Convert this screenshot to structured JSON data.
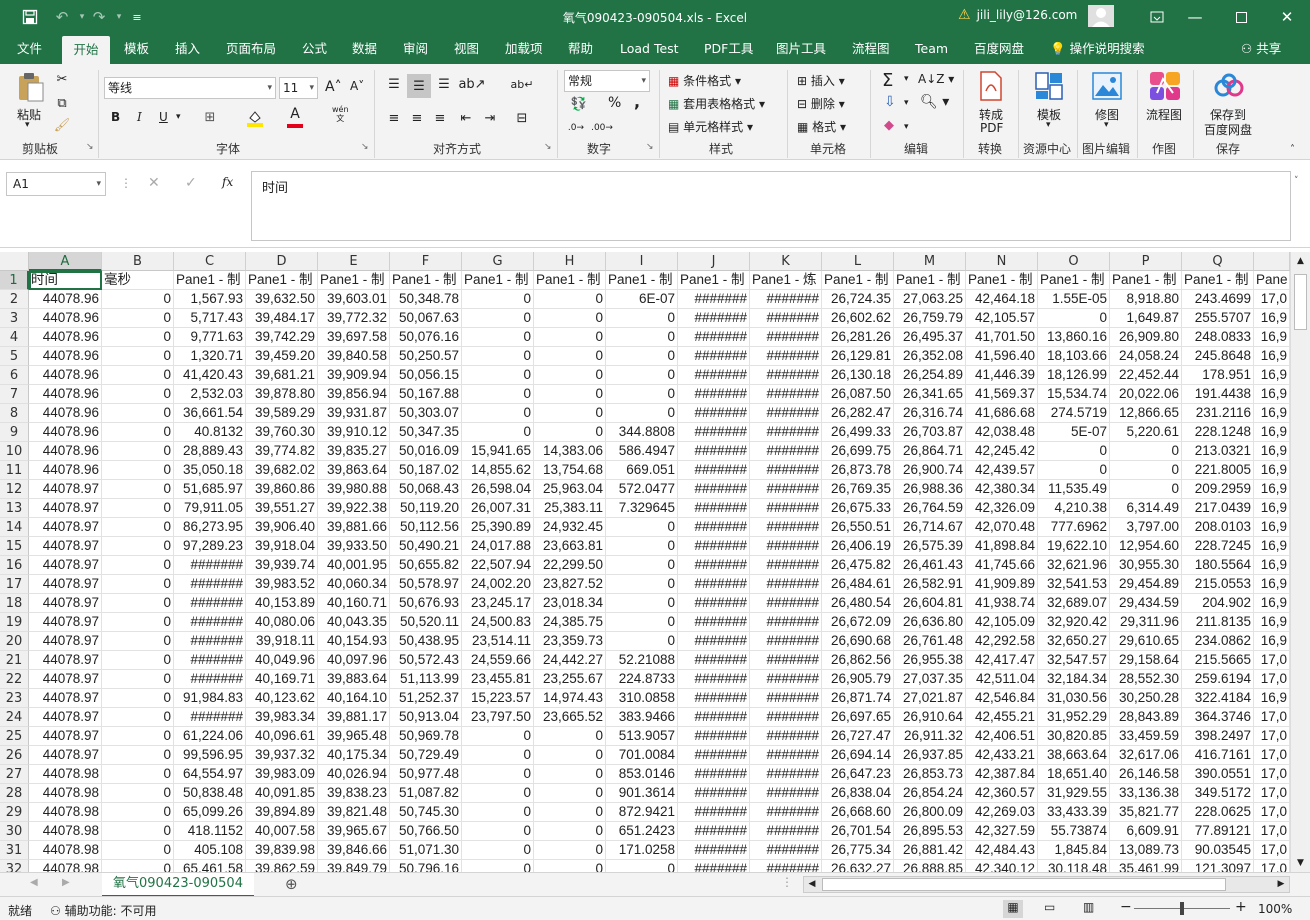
{
  "titlebar": {
    "title": "氧气090423-090504.xls  -  Excel",
    "user": "jili_lily@126.com",
    "save_icon": "save-icon",
    "undo_icon": "undo-icon",
    "redo_icon": "redo-icon",
    "warning_icon": "warning-icon"
  },
  "tabs": [
    "文件",
    "开始",
    "模板",
    "插入",
    "页面布局",
    "公式",
    "数据",
    "审阅",
    "视图",
    "加载项",
    "帮助",
    "Load Test",
    "PDF工具",
    "图片工具",
    "流程图",
    "Team",
    "百度网盘"
  ],
  "tell_me": "操作说明搜索",
  "share": "共享",
  "ribbon": {
    "paste": "粘贴",
    "clipboard": "剪贴板",
    "font_name": "等线",
    "font_size": "11",
    "font_group": "字体",
    "align_group": "对齐方式",
    "number_format": "常规",
    "number_group": "数字",
    "cond_format": "条件格式",
    "table_format": "套用表格格式",
    "cell_style": "单元格样式",
    "style_group": "样式",
    "insert": "插入",
    "delete": "删除",
    "format": "格式",
    "cells_group": "单元格",
    "edit_group": "编辑",
    "to_pdf1": "转成",
    "to_pdf2": "PDF",
    "convert_group": "转换",
    "template": "模板",
    "resource_group": "资源中心",
    "repair": "修图",
    "image_group": "图片编辑",
    "flowchart": "流程图",
    "draw_group": "作图",
    "save_to1": "保存到",
    "save_to2": "百度网盘",
    "save_group": "保存",
    "bold": "B",
    "italic": "I",
    "underline": "U",
    "wen": "wén\n文",
    "percent": "%",
    "comma": ",",
    "inc_font": "A˄",
    "dec_font": "A˅",
    "font_color_char": "A"
  },
  "formula_bar": {
    "name_box": "A1",
    "fx": "fx",
    "content": "时间"
  },
  "columns": [
    "A",
    "B",
    "C",
    "D",
    "E",
    "F",
    "G",
    "H",
    "I",
    "J",
    "K",
    "L",
    "M",
    "N",
    "O",
    "P",
    "Q",
    ""
  ],
  "rows": [
    [
      "时间",
      "毫秒",
      "Pane1 - 制",
      "Pane1 - 制",
      "Pane1 - 制",
      "Pane1 - 制",
      "Pane1 - 制",
      "Pane1 - 制",
      "Pane1 - 制",
      "Pane1 - 制",
      "Pane1 - 炼",
      "Pane1 - 制",
      "Pane1 - 制",
      "Pane1 - 制",
      "Pane1 - 制",
      "Pane1 - 制",
      "Pane1 - 制",
      "Pane"
    ],
    [
      "44078.96",
      "0",
      "1,567.93",
      "39,632.50",
      "39,603.01",
      "50,348.78",
      "0",
      "0",
      "6E-07",
      "#######",
      "#######",
      "26,724.35",
      "27,063.25",
      "42,464.18",
      "1.55E-05",
      "8,918.80",
      "243.4699",
      "17,0"
    ],
    [
      "44078.96",
      "0",
      "5,717.43",
      "39,484.17",
      "39,772.32",
      "50,067.63",
      "0",
      "0",
      "0",
      "#######",
      "#######",
      "26,602.62",
      "26,759.79",
      "42,105.57",
      "0",
      "1,649.87",
      "255.5707",
      "16,9"
    ],
    [
      "44078.96",
      "0",
      "9,771.63",
      "39,742.29",
      "39,697.58",
      "50,076.16",
      "0",
      "0",
      "0",
      "#######",
      "#######",
      "26,281.26",
      "26,495.37",
      "41,701.50",
      "13,860.16",
      "26,909.80",
      "248.0833",
      "16,9"
    ],
    [
      "44078.96",
      "0",
      "1,320.71",
      "39,459.20",
      "39,840.58",
      "50,250.57",
      "0",
      "0",
      "0",
      "#######",
      "#######",
      "26,129.81",
      "26,352.08",
      "41,596.40",
      "18,103.66",
      "24,058.24",
      "245.8648",
      "16,9"
    ],
    [
      "44078.96",
      "0",
      "41,420.43",
      "39,681.21",
      "39,909.94",
      "50,056.15",
      "0",
      "0",
      "0",
      "#######",
      "#######",
      "26,130.18",
      "26,254.89",
      "41,446.39",
      "18,126.99",
      "22,452.44",
      "178.951",
      "16,9"
    ],
    [
      "44078.96",
      "0",
      "2,532.03",
      "39,878.80",
      "39,856.94",
      "50,167.88",
      "0",
      "0",
      "0",
      "#######",
      "#######",
      "26,087.50",
      "26,341.65",
      "41,569.37",
      "15,534.74",
      "20,022.06",
      "191.4438",
      "16,9"
    ],
    [
      "44078.96",
      "0",
      "36,661.54",
      "39,589.29",
      "39,931.87",
      "50,303.07",
      "0",
      "0",
      "0",
      "#######",
      "#######",
      "26,282.47",
      "26,316.74",
      "41,686.68",
      "274.5719",
      "12,866.65",
      "231.2116",
      "16,9"
    ],
    [
      "44078.96",
      "0",
      "40.8132",
      "39,760.30",
      "39,910.12",
      "50,347.35",
      "0",
      "0",
      "344.8808",
      "#######",
      "#######",
      "26,499.33",
      "26,703.87",
      "42,038.48",
      "5E-07",
      "5,220.61",
      "228.1248",
      "16,9"
    ],
    [
      "44078.96",
      "0",
      "28,889.43",
      "39,774.82",
      "39,835.27",
      "50,016.09",
      "15,941.65",
      "14,383.06",
      "586.4947",
      "#######",
      "#######",
      "26,699.75",
      "26,864.71",
      "42,245.42",
      "0",
      "0",
      "213.0321",
      "16,9"
    ],
    [
      "44078.96",
      "0",
      "35,050.18",
      "39,682.02",
      "39,863.64",
      "50,187.02",
      "14,855.62",
      "13,754.68",
      "669.051",
      "#######",
      "#######",
      "26,873.78",
      "26,900.74",
      "42,439.57",
      "0",
      "0",
      "221.8005",
      "16,9"
    ],
    [
      "44078.97",
      "0",
      "51,685.97",
      "39,860.86",
      "39,980.88",
      "50,068.43",
      "26,598.04",
      "25,963.04",
      "572.0477",
      "#######",
      "#######",
      "26,769.35",
      "26,988.36",
      "42,380.34",
      "11,535.49",
      "0",
      "209.2959",
      "16,9"
    ],
    [
      "44078.97",
      "0",
      "79,911.05",
      "39,551.27",
      "39,922.38",
      "50,119.20",
      "26,007.31",
      "25,383.11",
      "7.329645",
      "#######",
      "#######",
      "26,675.33",
      "26,764.59",
      "42,326.09",
      "4,210.38",
      "6,314.49",
      "217.0439",
      "16,9"
    ],
    [
      "44078.97",
      "0",
      "86,273.95",
      "39,906.40",
      "39,881.66",
      "50,112.56",
      "25,390.89",
      "24,932.45",
      "0",
      "#######",
      "#######",
      "26,550.51",
      "26,714.67",
      "42,070.48",
      "777.6962",
      "3,797.00",
      "208.0103",
      "16,9"
    ],
    [
      "44078.97",
      "0",
      "97,289.23",
      "39,918.04",
      "39,933.50",
      "50,490.21",
      "24,017.88",
      "23,663.81",
      "0",
      "#######",
      "#######",
      "26,406.19",
      "26,575.39",
      "41,898.84",
      "19,622.10",
      "12,954.60",
      "228.7245",
      "16,9"
    ],
    [
      "44078.97",
      "0",
      "#######",
      "39,939.74",
      "40,001.95",
      "50,655.82",
      "22,507.94",
      "22,299.50",
      "0",
      "#######",
      "#######",
      "26,475.82",
      "26,461.43",
      "41,745.66",
      "32,621.96",
      "30,955.30",
      "180.5564",
      "16,9"
    ],
    [
      "44078.97",
      "0",
      "#######",
      "39,983.52",
      "40,060.34",
      "50,578.97",
      "24,002.20",
      "23,827.52",
      "0",
      "#######",
      "#######",
      "26,484.61",
      "26,582.91",
      "41,909.89",
      "32,541.53",
      "29,454.89",
      "215.0553",
      "16,9"
    ],
    [
      "44078.97",
      "0",
      "#######",
      "40,153.89",
      "40,160.71",
      "50,676.93",
      "23,245.17",
      "23,018.34",
      "0",
      "#######",
      "#######",
      "26,480.54",
      "26,604.81",
      "41,938.74",
      "32,689.07",
      "29,434.59",
      "204.902",
      "16,9"
    ],
    [
      "44078.97",
      "0",
      "#######",
      "40,080.06",
      "40,043.35",
      "50,520.11",
      "24,500.83",
      "24,385.75",
      "0",
      "#######",
      "#######",
      "26,672.09",
      "26,636.80",
      "42,105.09",
      "32,920.42",
      "29,311.96",
      "211.8135",
      "16,9"
    ],
    [
      "44078.97",
      "0",
      "#######",
      "39,918.11",
      "40,154.93",
      "50,438.95",
      "23,514.11",
      "23,359.73",
      "0",
      "#######",
      "#######",
      "26,690.68",
      "26,761.48",
      "42,292.58",
      "32,650.27",
      "29,610.65",
      "234.0862",
      "16,9"
    ],
    [
      "44078.97",
      "0",
      "#######",
      "40,049.96",
      "40,097.96",
      "50,572.43",
      "24,559.66",
      "24,442.27",
      "52.21088",
      "#######",
      "#######",
      "26,862.56",
      "26,955.38",
      "42,417.47",
      "32,547.57",
      "29,158.64",
      "215.5665",
      "17,0"
    ],
    [
      "44078.97",
      "0",
      "#######",
      "40,169.71",
      "39,883.64",
      "51,113.99",
      "23,455.81",
      "23,255.67",
      "224.8733",
      "#######",
      "#######",
      "26,905.79",
      "27,037.35",
      "42,511.04",
      "32,184.34",
      "28,552.30",
      "259.6194",
      "17,0"
    ],
    [
      "44078.97",
      "0",
      "91,984.83",
      "40,123.62",
      "40,164.10",
      "51,252.37",
      "15,223.57",
      "14,974.43",
      "310.0858",
      "#######",
      "#######",
      "26,871.74",
      "27,021.87",
      "42,546.84",
      "31,030.56",
      "30,250.28",
      "322.4184",
      "16,9"
    ],
    [
      "44078.97",
      "0",
      "#######",
      "39,983.34",
      "39,881.17",
      "50,913.04",
      "23,797.50",
      "23,665.52",
      "383.9466",
      "#######",
      "#######",
      "26,697.65",
      "26,910.64",
      "42,455.21",
      "31,952.29",
      "28,843.89",
      "364.3746",
      "17,0"
    ],
    [
      "44078.97",
      "0",
      "61,224.06",
      "40,096.61",
      "39,965.48",
      "50,969.78",
      "0",
      "0",
      "513.9057",
      "#######",
      "#######",
      "26,727.47",
      "26,911.32",
      "42,406.51",
      "30,820.85",
      "33,459.59",
      "398.2497",
      "17,0"
    ],
    [
      "44078.97",
      "0",
      "99,596.95",
      "39,937.32",
      "40,175.34",
      "50,729.49",
      "0",
      "0",
      "701.0084",
      "#######",
      "#######",
      "26,694.14",
      "26,937.85",
      "42,433.21",
      "38,663.64",
      "32,617.06",
      "416.7161",
      "17,0"
    ],
    [
      "44078.98",
      "0",
      "64,554.97",
      "39,983.09",
      "40,026.94",
      "50,977.48",
      "0",
      "0",
      "853.0146",
      "#######",
      "#######",
      "26,647.23",
      "26,853.73",
      "42,387.84",
      "18,651.40",
      "26,146.58",
      "390.0551",
      "17,0"
    ],
    [
      "44078.98",
      "0",
      "50,838.48",
      "40,091.85",
      "39,838.23",
      "51,087.82",
      "0",
      "0",
      "901.3614",
      "#######",
      "#######",
      "26,838.04",
      "26,854.24",
      "42,360.57",
      "31,929.55",
      "33,136.38",
      "349.5172",
      "17,0"
    ],
    [
      "44078.98",
      "0",
      "65,099.26",
      "39,894.89",
      "39,821.48",
      "50,745.30",
      "0",
      "0",
      "872.9421",
      "#######",
      "#######",
      "26,668.60",
      "26,800.09",
      "42,269.03",
      "33,433.39",
      "35,821.77",
      "228.0625",
      "17,0"
    ],
    [
      "44078.98",
      "0",
      "418.1152",
      "40,007.58",
      "39,965.67",
      "50,766.50",
      "0",
      "0",
      "651.2423",
      "#######",
      "#######",
      "26,701.54",
      "26,895.53",
      "42,327.59",
      "55.73874",
      "6,609.91",
      "77.89121",
      "17,0"
    ],
    [
      "44078.98",
      "0",
      "405.108",
      "39,839.98",
      "39,846.66",
      "51,071.30",
      "0",
      "0",
      "171.0258",
      "#######",
      "#######",
      "26,775.34",
      "26,881.42",
      "42,484.43",
      "1,845.84",
      "13,089.73",
      "90.03545",
      "17,0"
    ],
    [
      "44078.98",
      "0",
      "65,461.58",
      "39,862.59",
      "39,849.79",
      "50,796.16",
      "0",
      "0",
      "0",
      "#######",
      "#######",
      "26,632.27",
      "26,888.85",
      "42,340.12",
      "30,118.48",
      "35,461.99",
      "121.3097",
      "17,0"
    ]
  ],
  "sheet": {
    "name": "氧气090423-090504"
  },
  "status": {
    "ready": "就绪",
    "accessibility": "辅助功能: 不可用",
    "zoom": "100%"
  }
}
